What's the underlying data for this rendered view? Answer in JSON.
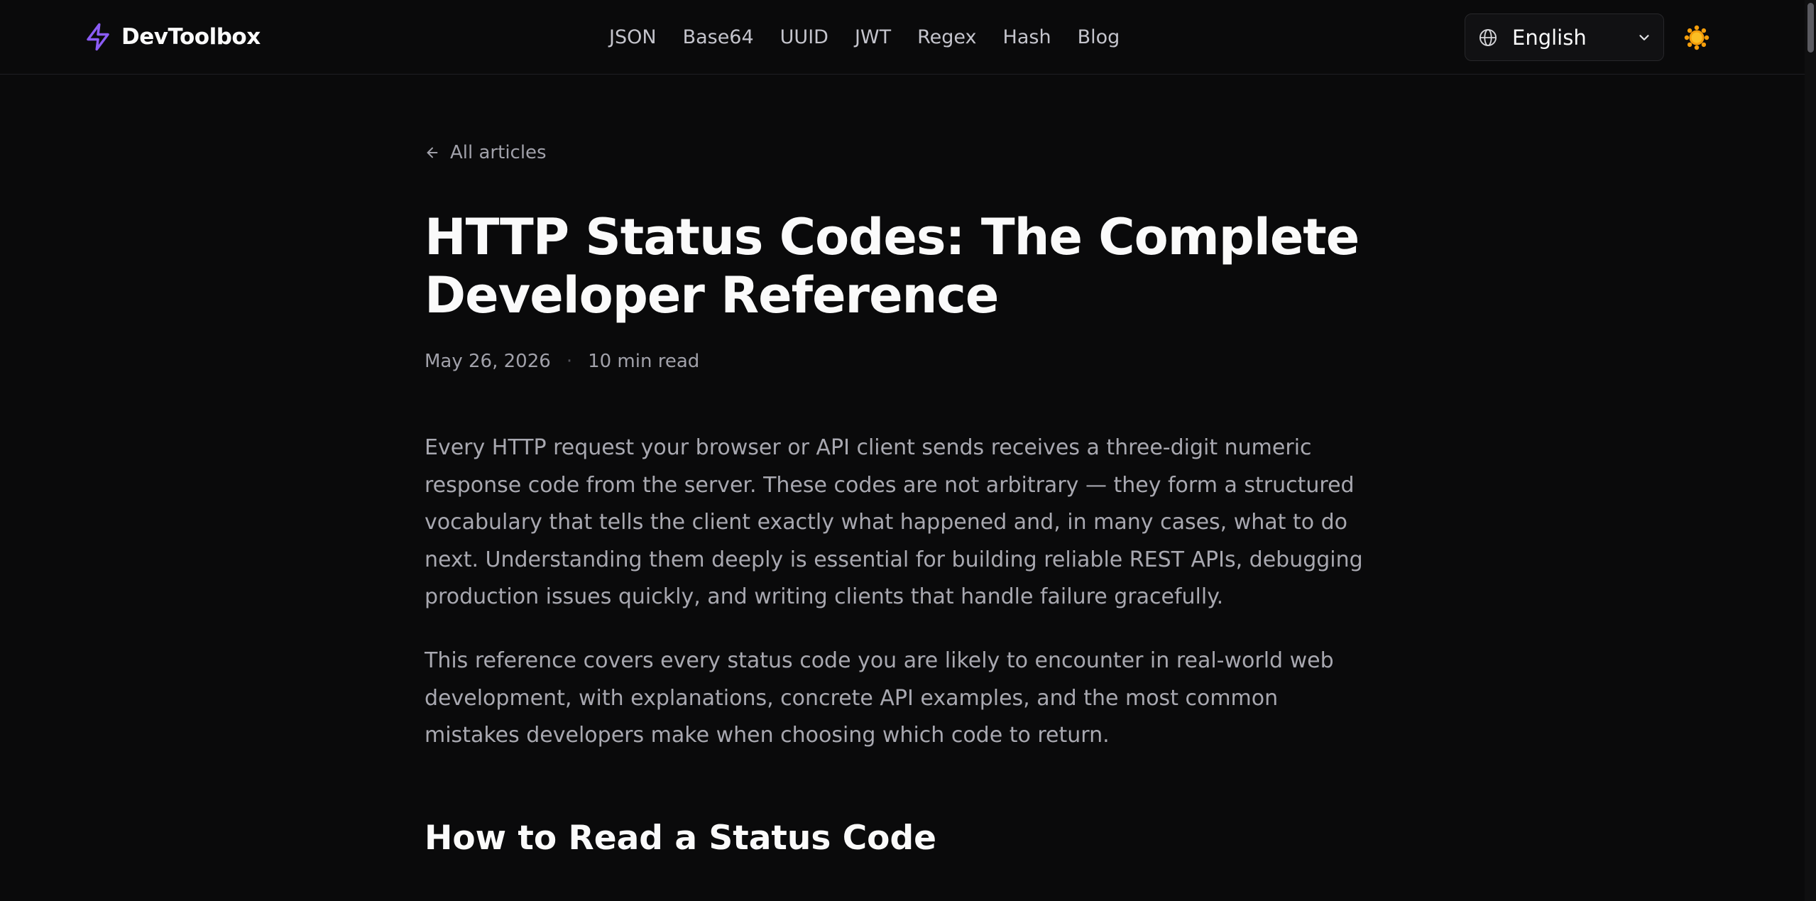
{
  "header": {
    "brand": "DevToolbox",
    "nav": [
      {
        "label": "JSON"
      },
      {
        "label": "Base64"
      },
      {
        "label": "UUID"
      },
      {
        "label": "JWT"
      },
      {
        "label": "Regex"
      },
      {
        "label": "Hash"
      },
      {
        "label": "Blog"
      }
    ],
    "language": "English"
  },
  "article": {
    "back_label": "All articles",
    "title": "HTTP Status Codes: The Complete Developer Reference",
    "date": "May 26, 2026",
    "separator": "·",
    "read_time": "10 min read",
    "paragraphs": [
      "Every HTTP request your browser or API client sends receives a three-digit numeric response code from the server. These codes are not arbitrary — they form a structured vocabulary that tells the client exactly what happened and, in many cases, what to do next. Understanding them deeply is essential for building reliable REST APIs, debugging production issues quickly, and writing clients that handle failure gracefully.",
      "This reference covers every status code you are likely to encounter in real-world web development, with explanations, concrete API examples, and the most common mistakes developers make when choosing which code to return."
    ],
    "section_heading": "How to Read a Status Code"
  },
  "colors": {
    "background": "#0a0a0b",
    "accent": "#8b5cf6",
    "text": "#fafafa",
    "muted": "#a1a1aa",
    "theme_icon": "#f59e0b"
  },
  "icons": {
    "brand": "bolt-icon",
    "language": "globe-icon",
    "dropdown": "chevron-down-icon",
    "theme": "sun-icon",
    "back": "arrow-left-icon"
  }
}
